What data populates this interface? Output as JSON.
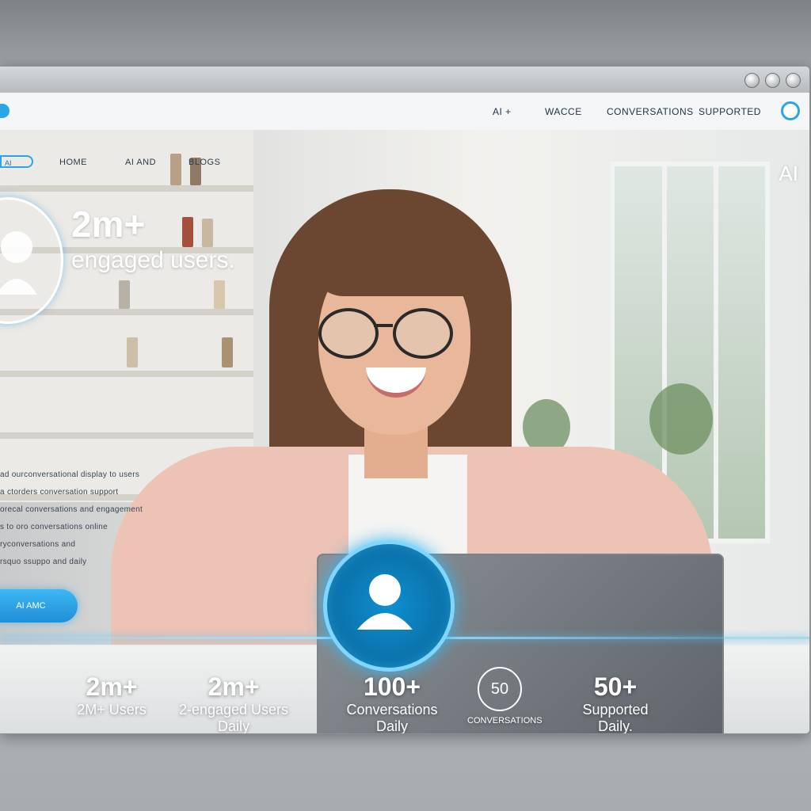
{
  "colors": {
    "accent": "#2aa6e8",
    "text_light": "#ffffff",
    "nav_text": "#243447"
  },
  "window": {
    "controls": [
      "minimize-icon",
      "maximize-icon",
      "close-icon"
    ]
  },
  "navbar": {
    "links": [
      "AI +",
      "WACCE",
      "CONVERSATIONS",
      "SUPPORTED"
    ]
  },
  "left_tabs": {
    "chip": "AI",
    "items": [
      "HOME",
      "AI AND",
      "BLOGS"
    ]
  },
  "brand": "AI",
  "hero": {
    "number": "2m+",
    "subtitle": "engaged users."
  },
  "blurb": {
    "lines": [
      "ad ourconversational display to users",
      "a ctorders conversation support",
      "orecal conversations and engagement",
      "s to oro conversations online",
      "ryconversations and",
      "rsquo ssuppo and daily"
    ]
  },
  "cta": {
    "label": "AI AMC"
  },
  "stats": [
    {
      "number": "2m+",
      "label": "2M+ Users"
    },
    {
      "number": "2m+",
      "label": "2-engaged Users Daily"
    },
    {
      "number": "100+",
      "label": "Conversations Daily"
    },
    {
      "number": "+",
      "label": "CONVERSATIONS",
      "badge": "50"
    },
    {
      "number": "50+",
      "label": "Supported Daily."
    }
  ]
}
